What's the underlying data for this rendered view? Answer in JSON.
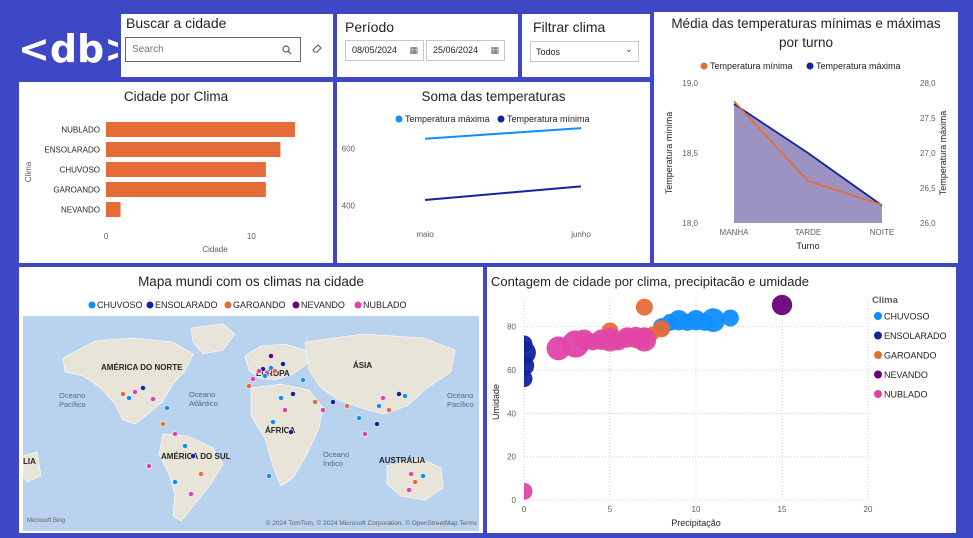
{
  "logo_text": "<db>",
  "search_slicer": {
    "title": "Buscar a cidade",
    "placeholder": "Search"
  },
  "period_slicer": {
    "title": "Período",
    "start": "08/05/2024",
    "end": "25/06/2024"
  },
  "weather_filter": {
    "title": "Filtrar clima",
    "selected": "Todos"
  },
  "colors": {
    "chuvoso": "#118DFF",
    "ensolarado": "#12239E",
    "garoando": "#E66C37",
    "nevando": "#6B007B",
    "nublado": "#E044A7",
    "bar": "#E66C37",
    "area": "#7B6FAF"
  },
  "chart_data": [
    {
      "id": "temp-by-shift",
      "type": "line",
      "title": "Média das temperaturas mínimas e máximas por turno",
      "categories": [
        "MANHA",
        "TARDE",
        "NOITE"
      ],
      "xlabel": "Turno",
      "ylabel": "Temperatura mínima",
      "y2label": "Temperatura máxima",
      "ylim": [
        18.0,
        19.0
      ],
      "yticks": [
        "19,0",
        "18,5",
        "18,0"
      ],
      "y2lim": [
        26.0,
        28.0
      ],
      "y2ticks": [
        "28,0",
        "27,5",
        "27,0",
        "26,5",
        "26,0"
      ],
      "legend_position": "top",
      "series": [
        {
          "name": "Temperatura mínima",
          "axis": "left",
          "values": [
            18.87,
            18.3,
            18.13
          ]
        },
        {
          "name": "Temperatura máxima",
          "axis": "right",
          "values": [
            27.7,
            27.0,
            26.25
          ]
        }
      ]
    },
    {
      "id": "city-by-weather",
      "type": "bar",
      "title": "Cidade por Clima",
      "categories": [
        "NUBLADO",
        "ENSOLARADO",
        "CHUVOSO",
        "GAROANDO",
        "NEVANDO"
      ],
      "values": [
        13,
        12,
        11,
        11,
        1
      ],
      "xlabel": "Cidade",
      "ylabel": "Clima",
      "xlim": [
        0,
        15
      ],
      "xticks": [
        "0",
        "10"
      ]
    },
    {
      "id": "temp-sum",
      "type": "line",
      "title": "Soma das temperaturas",
      "categories": [
        "maio",
        "junho"
      ],
      "yticks": [
        "600",
        "400"
      ],
      "ylim": [
        380,
        760
      ],
      "legend_position": "top",
      "series": [
        {
          "name": "Temperatura máxima",
          "values": [
            635,
            672
          ]
        },
        {
          "name": "Temperatura mínima",
          "values": [
            420,
            468
          ]
        }
      ]
    },
    {
      "id": "weather-map",
      "type": "scatter",
      "title": "Mapa mundi com os climas na cidade",
      "legend": [
        "CHUVOSO",
        "ENSOLARADO",
        "GAROANDO",
        "NEVANDO",
        "NUBLADO"
      ],
      "map_labels": {
        "north_america": "AMÉRICA DO NORTE",
        "europe": "EUROPA",
        "asia": "ÁSIA",
        "africa": "ÁFRICA",
        "south_america": "AMÉRICA DO SUL",
        "australia": "AUSTRÁLIA",
        "pacific": "Oceano\nPacífico",
        "atlantic": "Oceano\nAtlântico",
        "indian": "Oceano\nÍndico",
        "pacific_east": "Oceano\nPacífico",
        "left_edge": "LIA"
      },
      "attribution": "© 2024 TomTom, © 2024 Microsoft Corporation, © OpenStreetMap  Terms",
      "bing_label": "Microsoft Bing"
    },
    {
      "id": "bubble",
      "type": "scatter",
      "title": "Contagem de cidade por clima, precipitacão e umidade",
      "xlabel": "Precipitação",
      "ylabel": "Umidade",
      "xlim": [
        0,
        20
      ],
      "ylim": [
        0,
        90
      ],
      "xticks": [
        "0",
        "5",
        "10",
        "15",
        "20"
      ],
      "yticks": [
        "80",
        "60",
        "40",
        "20",
        "0"
      ],
      "legend_title": "Clima",
      "legend": [
        "CHUVOSO",
        "ENSOLARADO",
        "GAROANDO",
        "NEVANDO",
        "NUBLADO"
      ],
      "series": [
        {
          "name": "CHUVOSO",
          "points": [
            [
              8,
              80,
              5
            ],
            [
              8.5,
              82,
              5
            ],
            [
              9,
              83,
              6
            ],
            [
              9.5,
              82,
              5
            ],
            [
              10,
              83,
              6
            ],
            [
              10.5,
              82,
              5
            ],
            [
              11,
              83,
              7
            ],
            [
              12,
              84,
              5
            ]
          ]
        },
        {
          "name": "ENSOLARADO",
          "points": [
            [
              0,
              68,
              7
            ],
            [
              0,
              62,
              6
            ],
            [
              0,
              56,
              5
            ],
            [
              0,
              72,
              5
            ]
          ]
        },
        {
          "name": "GAROANDO",
          "points": [
            [
              5,
              78,
              5
            ],
            [
              6,
              76,
              4
            ],
            [
              6.5,
              74,
              5
            ],
            [
              7,
              75,
              6
            ],
            [
              7,
              89,
              5
            ],
            [
              7.5,
              77,
              4
            ],
            [
              8,
              79,
              5
            ]
          ]
        },
        {
          "name": "NEVANDO",
          "points": [
            [
              15,
              90,
              6
            ]
          ]
        },
        {
          "name": "NUBLADO",
          "points": [
            [
              0,
              4,
              5
            ],
            [
              2,
              70,
              7
            ],
            [
              3,
              72,
              8
            ],
            [
              3.5,
              74,
              6
            ],
            [
              4,
              73,
              5
            ],
            [
              4.5,
              74,
              6
            ],
            [
              5,
              74,
              7
            ],
            [
              5.5,
              73,
              5
            ],
            [
              6,
              75,
              6
            ],
            [
              6.5,
              76,
              5
            ],
            [
              7,
              74,
              7
            ]
          ]
        }
      ]
    }
  ]
}
